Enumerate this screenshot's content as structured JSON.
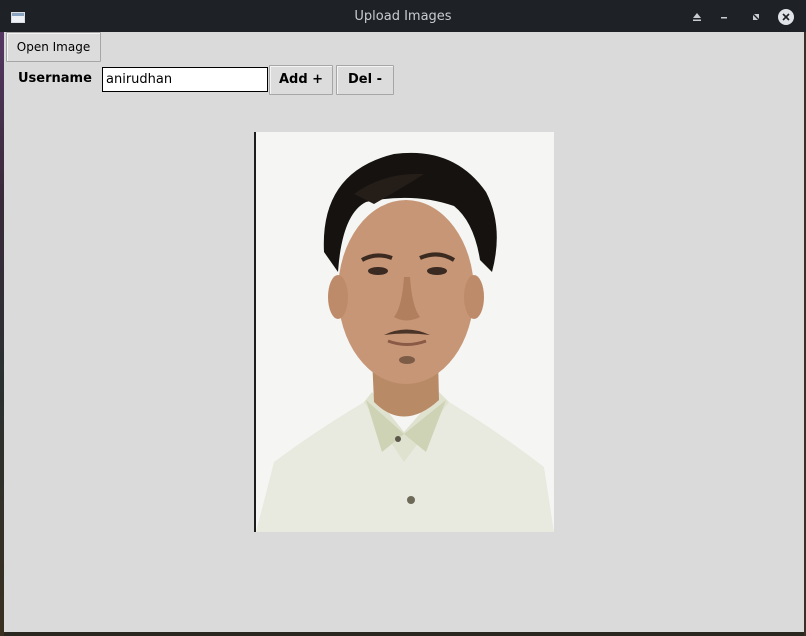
{
  "window": {
    "title": "Upload Images"
  },
  "toolbar": {
    "open_image_label": "Open Image",
    "username_label": "Username",
    "username_value": "anirudhan",
    "add_label": "Add +",
    "del_label": "Del -"
  },
  "icons": {
    "app": "window-icon",
    "keep_above": "eject-up-icon",
    "minimize": "minimize-icon",
    "maximize": "maximize-icon",
    "close": "close-icon"
  },
  "colors": {
    "titlebar": "#1e2126",
    "window_bg": "#dadada",
    "button_bg": "#dcdcdc"
  }
}
